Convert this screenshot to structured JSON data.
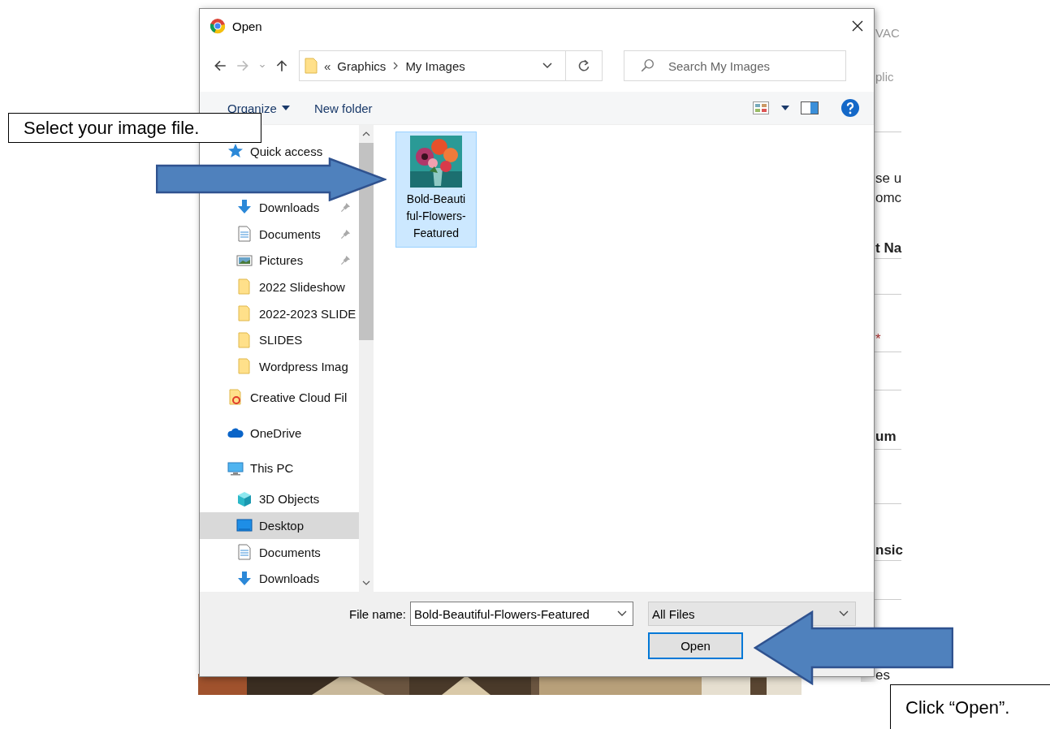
{
  "window": {
    "title": "Open"
  },
  "address": {
    "prefix": "«",
    "path": [
      "Graphics",
      "My Images"
    ]
  },
  "search": {
    "placeholder": "Search My Images"
  },
  "toolbar": {
    "organize": "Organize",
    "new_folder": "New folder"
  },
  "nav": [
    {
      "label": "Quick access",
      "kind": "star",
      "selected": false,
      "children": [
        {
          "label": "Downloads",
          "kind": "download",
          "pinned": true,
          "selected": false
        },
        {
          "label": "Documents",
          "kind": "document",
          "pinned": true,
          "selected": false
        },
        {
          "label": "Pictures",
          "kind": "pictures",
          "pinned": true,
          "selected": false
        },
        {
          "label": "2022 Slideshow",
          "kind": "folder",
          "pinned": false,
          "selected": false
        },
        {
          "label": "2022-2023 SLIDE",
          "kind": "folder",
          "pinned": false,
          "selected": false
        },
        {
          "label": "SLIDES",
          "kind": "folder",
          "pinned": false,
          "selected": false
        },
        {
          "label": "Wordpress Imag",
          "kind": "folder",
          "pinned": false,
          "selected": false
        }
      ]
    },
    {
      "label": "Creative Cloud Fil",
      "kind": "cc",
      "selected": false
    },
    {
      "label": "OneDrive",
      "kind": "cloud",
      "selected": false
    },
    {
      "label": "This PC",
      "kind": "pc",
      "selected": false,
      "children": [
        {
          "label": "3D Objects",
          "kind": "cube",
          "pinned": false,
          "selected": false
        },
        {
          "label": "Desktop",
          "kind": "desktop",
          "pinned": false,
          "selected": true
        },
        {
          "label": "Documents",
          "kind": "document",
          "pinned": false,
          "selected": false
        },
        {
          "label": "Downloads",
          "kind": "download",
          "pinned": false,
          "selected": false
        }
      ]
    }
  ],
  "files": [
    {
      "name": "Bold-Beautiful-Flowers-Featured",
      "selected": true,
      "kind": "picture"
    }
  ],
  "file_name": {
    "label": "File name:",
    "value": "Bold-Beautiful-Flowers-Featured"
  },
  "file_type": {
    "value": "All Files"
  },
  "buttons": [
    {
      "label": "Open",
      "focused": true
    }
  ],
  "background_page": [
    {
      "text": "VAC",
      "kind": "grey"
    },
    {
      "text": "plic",
      "kind": "grey"
    },
    {
      "text": "se u",
      "kind": "plain"
    },
    {
      "text": "omc",
      "kind": "plain"
    },
    {
      "text": "t Na",
      "kind": "bold"
    },
    {
      "text": "*",
      "kind": "required"
    },
    {
      "text": "um",
      "kind": "bold"
    },
    {
      "text": "nsic",
      "kind": "bold"
    },
    {
      "text": "es",
      "kind": "plain"
    }
  ],
  "callouts": [
    {
      "text": "Select your image file."
    },
    {
      "text": "Click “Open”."
    }
  ]
}
